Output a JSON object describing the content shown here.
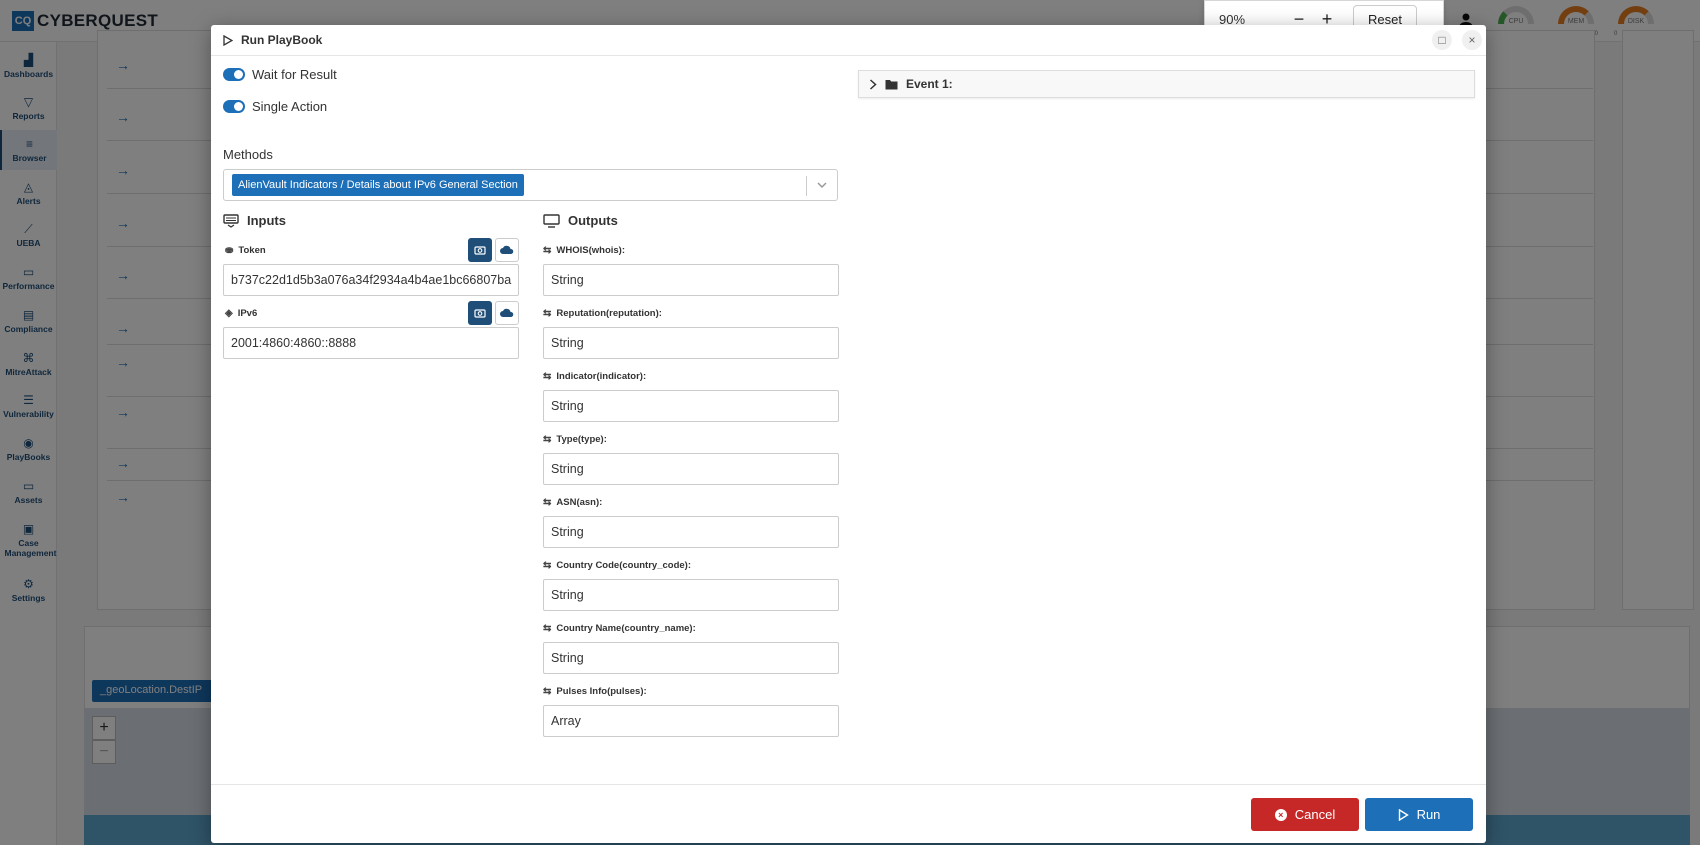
{
  "app": {
    "brand_mark": "CQ",
    "brand_name": "CYBERQUEST"
  },
  "gauges": [
    {
      "label": "CPU",
      "min": "0",
      "max": "100",
      "color": "#4caf50"
    },
    {
      "label": "MEM",
      "min": "0",
      "max": "100",
      "color": "#e67e22"
    },
    {
      "label": "DISK",
      "min": "0",
      "max": "100",
      "color": "#e67e22"
    }
  ],
  "sidebar": {
    "items": [
      {
        "label": "Dashboards",
        "icon": "dashboard-icon"
      },
      {
        "label": "Reports",
        "icon": "filter-icon"
      },
      {
        "label": "Browser",
        "icon": "list-icon",
        "active": true
      },
      {
        "label": "Alerts",
        "icon": "bell-icon"
      },
      {
        "label": "UEBA",
        "icon": "chart-line-icon"
      },
      {
        "label": "Performance",
        "icon": "keyboard-icon"
      },
      {
        "label": "Compliance",
        "icon": "document-check-icon"
      },
      {
        "label": "MitreAttack",
        "icon": "command-icon"
      },
      {
        "label": "Vulnerability",
        "icon": "toggle-icon"
      },
      {
        "label": "PlayBooks",
        "icon": "playbook-icon"
      },
      {
        "label": "Assets",
        "icon": "laptop-icon"
      },
      {
        "label": "Case Management",
        "icon": "briefcase-icon"
      },
      {
        "label": "Settings",
        "icon": "gear-icon"
      }
    ]
  },
  "background": {
    "geo_chip": "_geoLocation.DestIP"
  },
  "zoom": {
    "level": "90%",
    "minus": "−",
    "plus": "+",
    "reset": "Reset"
  },
  "modal": {
    "title": "Run PlayBook",
    "toggles": [
      {
        "label": "Wait for Result",
        "on": true
      },
      {
        "label": "Single Action",
        "on": true
      }
    ],
    "methods": {
      "label": "Methods",
      "selected": "AlienVault Indicators / Details about IPv6 General Section"
    },
    "inputs": {
      "title": "Inputs",
      "fields": [
        {
          "label": "Token",
          "value": "b737c22d1d5b3a076a34f2934a4b4ae1bc66807ba"
        },
        {
          "label": "IPv6",
          "value": "2001:4860:4860::8888"
        }
      ]
    },
    "outputs": {
      "title": "Outputs",
      "fields": [
        {
          "label": "WHOIS(whois):",
          "value": "String"
        },
        {
          "label": "Reputation(reputation):",
          "value": "String"
        },
        {
          "label": "Indicator(indicator):",
          "value": "String"
        },
        {
          "label": "Type(type):",
          "value": "String"
        },
        {
          "label": "ASN(asn):",
          "value": "String"
        },
        {
          "label": "Country Code(country_code):",
          "value": "String"
        },
        {
          "label": "Country Name(country_name):",
          "value": "String"
        },
        {
          "label": "Pulses Info(pulses):",
          "value": "Array"
        }
      ]
    },
    "event": {
      "label": "Event 1:"
    },
    "footer": {
      "cancel": "Cancel",
      "run": "Run"
    }
  },
  "colors": {
    "primary": "#1d6fb8",
    "navy": "#1f4e79",
    "danger": "#c62828"
  }
}
